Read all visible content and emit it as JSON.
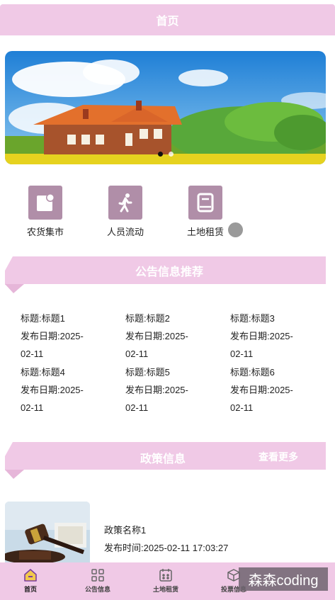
{
  "header": {
    "title": "首页"
  },
  "banner": {
    "slides": 2,
    "active_slide": 1
  },
  "quick_links": [
    {
      "label": "农货集市",
      "icon": "market-icon"
    },
    {
      "label": "人员流动",
      "icon": "walking-person-icon"
    },
    {
      "label": "土地租赁",
      "icon": "book-icon"
    }
  ],
  "notice_section": {
    "title": "公告信息推荐",
    "items": [
      {
        "title": "标题:标题1",
        "date_line1": "发布日期:2025-",
        "date_line2": "02-11"
      },
      {
        "title": "标题:标题2",
        "date_line1": "发布日期:2025-",
        "date_line2": "02-11"
      },
      {
        "title": "标题:标题3",
        "date_line1": "发布日期:2025-",
        "date_line2": "02-11"
      },
      {
        "title": "标题:标题4",
        "date_line1": "发布日期:2025-",
        "date_line2": "02-11"
      },
      {
        "title": "标题:标题5",
        "date_line1": "发布日期:2025-",
        "date_line2": "02-11"
      },
      {
        "title": "标题:标题6",
        "date_line1": "发布日期:2025-",
        "date_line2": "02-11"
      }
    ]
  },
  "policy_section": {
    "title": "政策信息",
    "more_label": "查看更多",
    "items": [
      {
        "name": "政策名称1",
        "time": "发布时间:2025-02-11 17:03:27"
      }
    ]
  },
  "tabbar": {
    "items": [
      {
        "label": "首页",
        "icon": "home-icon",
        "active": true
      },
      {
        "label": "公告信息",
        "icon": "grid-icon",
        "active": false
      },
      {
        "label": "土地租赁",
        "icon": "calendar-icon",
        "active": false
      },
      {
        "label": "投票信息",
        "icon": "box-icon",
        "active": false
      }
    ]
  },
  "watermark": {
    "text": "森森coding"
  },
  "colors": {
    "theme_pink": "#f0c9e6",
    "icon_bg": "#b08ea8"
  }
}
